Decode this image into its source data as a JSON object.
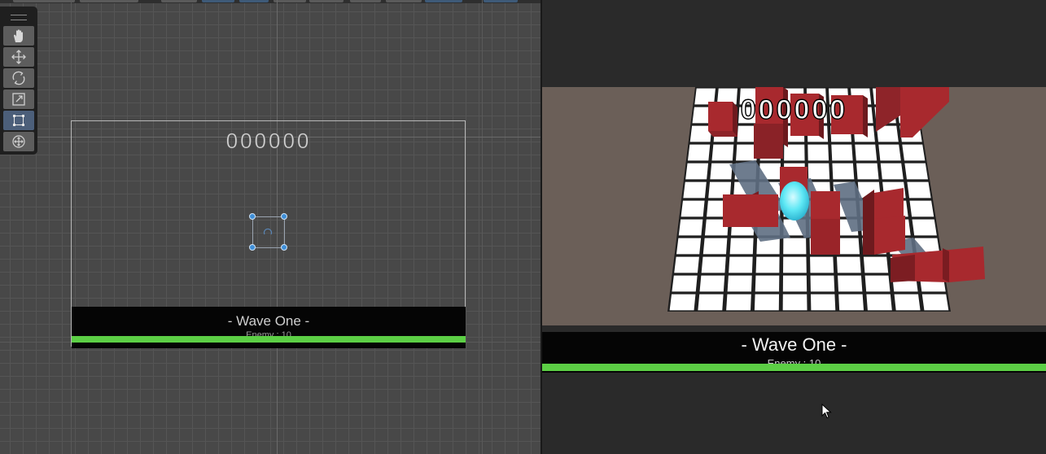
{
  "scene": {
    "score_text": "000000",
    "banner": {
      "wave_title": "- Wave One -",
      "enemy_text": "Enemy : 10",
      "health_fill": 1.0
    },
    "tools": [
      {
        "name": "hand-tool",
        "icon": "hand-icon",
        "active": false
      },
      {
        "name": "move-tool",
        "icon": "move-arrows-icon",
        "active": false
      },
      {
        "name": "rotate-tool",
        "icon": "rotate-icon",
        "active": false
      },
      {
        "name": "scale-tool",
        "icon": "scale-icon",
        "active": false
      },
      {
        "name": "rect-tool",
        "icon": "rect-transform-icon",
        "active": true
      },
      {
        "name": "transform-tool",
        "icon": "transform-icon",
        "active": false
      }
    ]
  },
  "game": {
    "score_text": "000000",
    "banner": {
      "wave_title": "- Wave One -",
      "enemy_text": "Enemy : 10",
      "health_fill": 1.0
    }
  },
  "colors": {
    "health_bar": "#5ccf45",
    "cube_red": "#a8292e",
    "player_cyan": "#5fe8f5",
    "selection_blue": "#3f8fd8"
  }
}
